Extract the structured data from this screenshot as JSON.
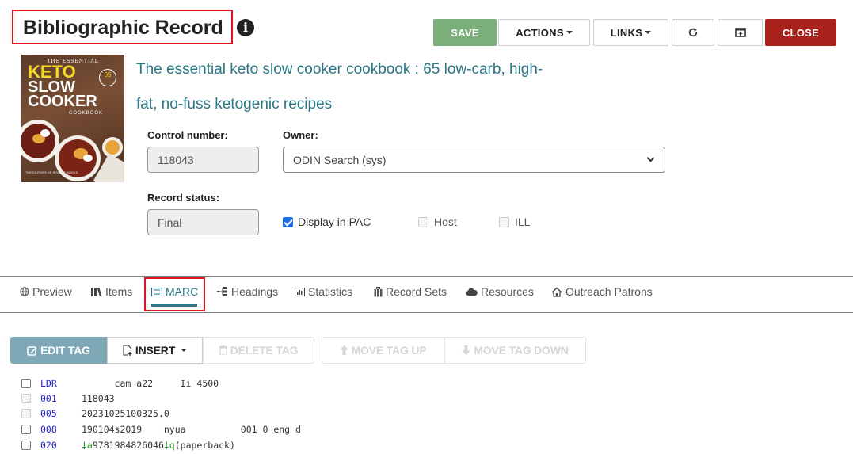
{
  "header": {
    "title": "Bibliographic Record",
    "info_icon": "i",
    "buttons": {
      "save": "SAVE",
      "actions": "ACTIONS",
      "links": "LINKS",
      "refresh_icon": "↻",
      "close": "CLOSE"
    }
  },
  "cover": {
    "line1": "THE ESSENTIAL",
    "line2": "KETO",
    "line3": "SLOW",
    "line4": "COOKER",
    "line5": "COOKBOOK",
    "badge": "65",
    "authors": "THE EDITORS OF RODALE BOOKS"
  },
  "record": {
    "title_line1": "The essential keto slow cooker cookbook : 65 low-carb, high-",
    "title_line2": "fat, no-fuss ketogenic recipes",
    "control_number_label": "Control number:",
    "control_number": "118043",
    "owner_label": "Owner:",
    "owner_value": "ODIN Search (sys)",
    "record_status_label": "Record status:",
    "record_status": "Final",
    "checkboxes": [
      {
        "label": "Display in PAC",
        "checked": true
      },
      {
        "label": "Host",
        "checked": false
      },
      {
        "label": "ILL",
        "checked": false
      }
    ]
  },
  "tabs": [
    {
      "label": "Preview",
      "icon": "globe-icon"
    },
    {
      "label": "Items",
      "icon": "books-icon"
    },
    {
      "label": "MARC",
      "icon": "list-icon",
      "active": true
    },
    {
      "label": "Headings",
      "icon": "tree-icon"
    },
    {
      "label": "Statistics",
      "icon": "bar-chart-icon"
    },
    {
      "label": "Record Sets",
      "icon": "briefcase-icon"
    },
    {
      "label": "Resources",
      "icon": "cloud-icon"
    },
    {
      "label": "Outreach Patrons",
      "icon": "home-icon"
    }
  ],
  "marc_toolbar": {
    "edit": "EDIT TAG",
    "insert": "INSERT",
    "delete": "DELETE TAG",
    "move_up": "MOVE TAG UP",
    "move_down": "MOVE TAG DOWN"
  },
  "marc": [
    {
      "tag": "LDR",
      "value": "      cam a22     Ii 4500",
      "editable": true
    },
    {
      "tag": "001",
      "value": "118043",
      "editable": false
    },
    {
      "tag": "005",
      "value": "20231025100325.0",
      "editable": false
    },
    {
      "tag": "008",
      "value": "190104s2019    nyua          001 0 eng d",
      "editable": true
    },
    {
      "tag": "020",
      "sub_a_code": "‡a",
      "sub_a": "9781984826046",
      "sub_q_code": "‡q",
      "sub_q": "(paperback)",
      "editable": true
    }
  ],
  "colors": {
    "accent": "#2a7785",
    "save": "#7aae7a",
    "close": "#a6221a",
    "edit_tag": "#7ea8b6",
    "highlight": "#e0141e",
    "marc_tag": "#2222cc",
    "subfield": "#1a9a1a"
  }
}
